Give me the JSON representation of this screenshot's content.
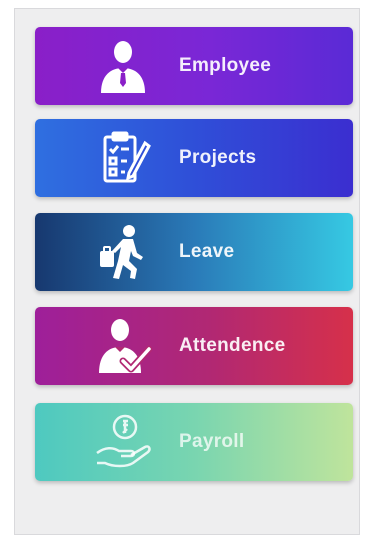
{
  "menu": {
    "items": [
      {
        "label": "Employee",
        "icon": "employee-icon"
      },
      {
        "label": "Projects",
        "icon": "clipboard-checklist-icon"
      },
      {
        "label": "Leave",
        "icon": "walking-person-with-bag-icon"
      },
      {
        "label": "Attendence",
        "icon": "person-checkmark-icon"
      },
      {
        "label": "Payroll",
        "icon": "hand-coin-icon"
      }
    ]
  },
  "colors": {
    "employee": "#8a1fc8",
    "projects": "#2f4fd8",
    "leave": "#2a7ab8",
    "attendence": "#b12873",
    "payroll": "#79d5b0"
  }
}
